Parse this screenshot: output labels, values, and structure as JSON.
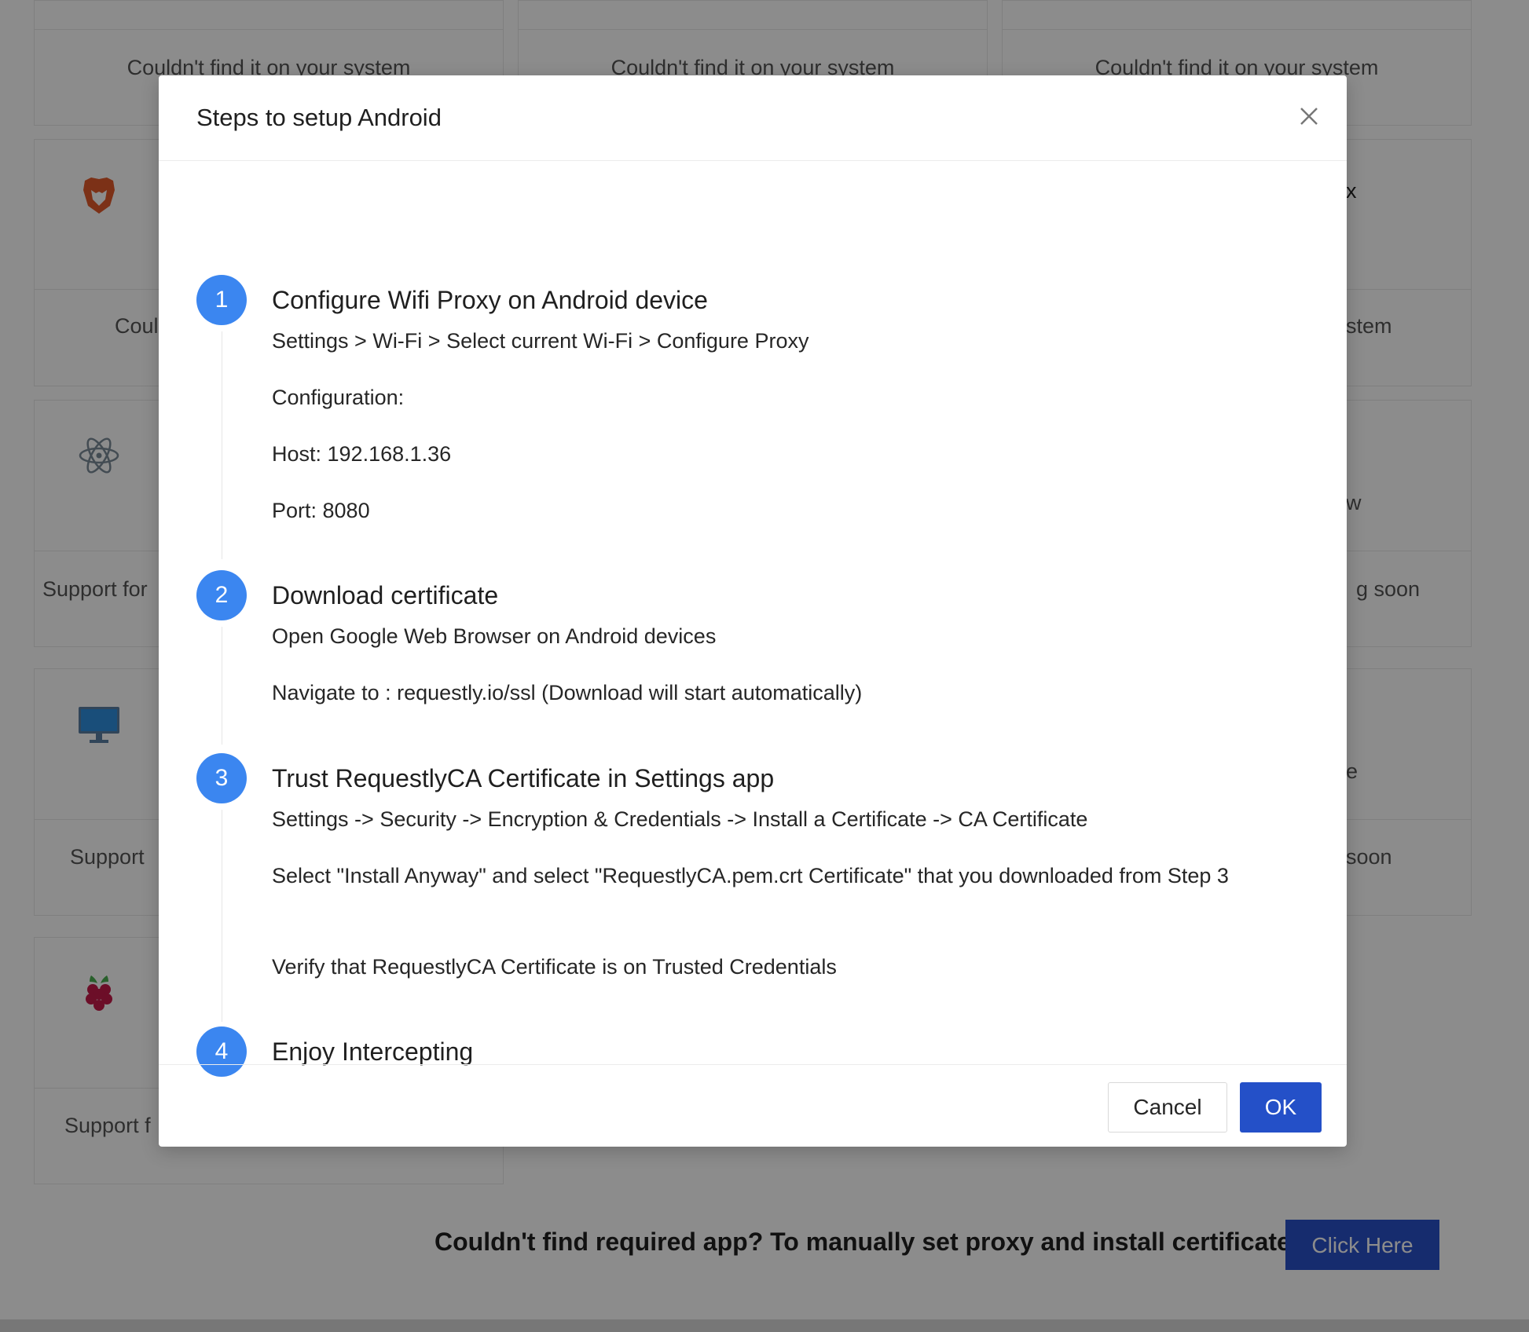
{
  "background": {
    "cards": {
      "row1_status": [
        "Couldn't find it on your system",
        "Couldn't find it on your system",
        "Couldn't find it on your system"
      ],
      "row2": {
        "left_status": "Coul",
        "right_name": "x",
        "right_status": "stem"
      },
      "row3": {
        "left_status": "Support for",
        "right_top": "w",
        "right_status": "g soon"
      },
      "row4": {
        "left_status": "Support ",
        "right_top": "e",
        "right_status": "soon"
      },
      "row5": {
        "left_status": "Support f"
      }
    },
    "icons": {
      "brave": "brave-lion-icon",
      "electron": "electron-atom-icon",
      "desktop": "monitor-icon",
      "raspberry": "raspberry-pi-icon"
    },
    "footer_text": "Couldn't find required app? To manually set proxy and install certificate",
    "click_here_label": "Click Here",
    "colors": {
      "accent": "#2950c8",
      "step_blue": "#3b86f0"
    }
  },
  "modal": {
    "title": "Steps to setup Android",
    "close_icon": "close-icon",
    "steps": [
      {
        "number": "1",
        "title": "Configure Wifi Proxy on Android device",
        "lines": [
          "Settings > Wi-Fi > Select current Wi-Fi > Configure Proxy",
          "Configuration:",
          "Host: 192.168.1.36",
          "Port: 8080"
        ]
      },
      {
        "number": "2",
        "title": "Download certificate",
        "lines": [
          "Open Google Web Browser on Android devices",
          "Navigate to : requestly.io/ssl (Download will start automatically)"
        ]
      },
      {
        "number": "3",
        "title": "Trust RequestlyCA Certificate in Settings app",
        "lines": [
          "Settings -> Security -> Encryption & Credentials -> Install a Certificate -> CA Certificate",
          "Select \"Install Anyway\" and select \"RequestlyCA.pem.crt Certificate\" that you downloaded from Step 3",
          "Verify that RequestlyCA Certificate is on Trusted Credentials"
        ]
      },
      {
        "number": "4",
        "title": "Enjoy Intercepting",
        "lines": []
      }
    ],
    "cancel_label": "Cancel",
    "ok_label": "OK"
  }
}
